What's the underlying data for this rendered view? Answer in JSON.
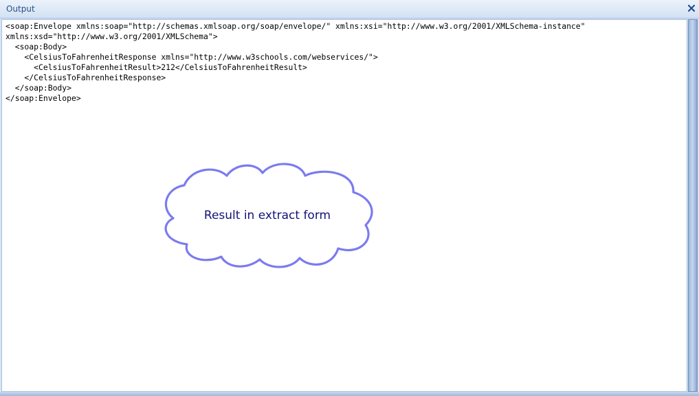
{
  "panel": {
    "title": "Output",
    "close_icon": "close-icon"
  },
  "output": {
    "lines": [
      "<soap:Envelope xmlns:soap=\"http://schemas.xmlsoap.org/soap/envelope/\" xmlns:xsi=\"http://www.w3.org/2001/XMLSchema-instance\"",
      "xmlns:xsd=\"http://www.w3.org/2001/XMLSchema\">",
      "  <soap:Body>",
      "    <CelsiusToFahrenheitResponse xmlns=\"http://www.w3schools.com/webservices/\">",
      "      <CelsiusToFahrenheitResult>212</CelsiusToFahrenheitResult>",
      "    </CelsiusToFahrenheitResponse>",
      "  </soap:Body>",
      "</soap:Envelope>"
    ]
  },
  "callout": {
    "text": "Result in extract form",
    "stroke_color": "#7b7bef",
    "text_color": "#12127a"
  },
  "colors": {
    "title_text": "#2a4f86",
    "panel_bg": "#d6e4f5"
  }
}
